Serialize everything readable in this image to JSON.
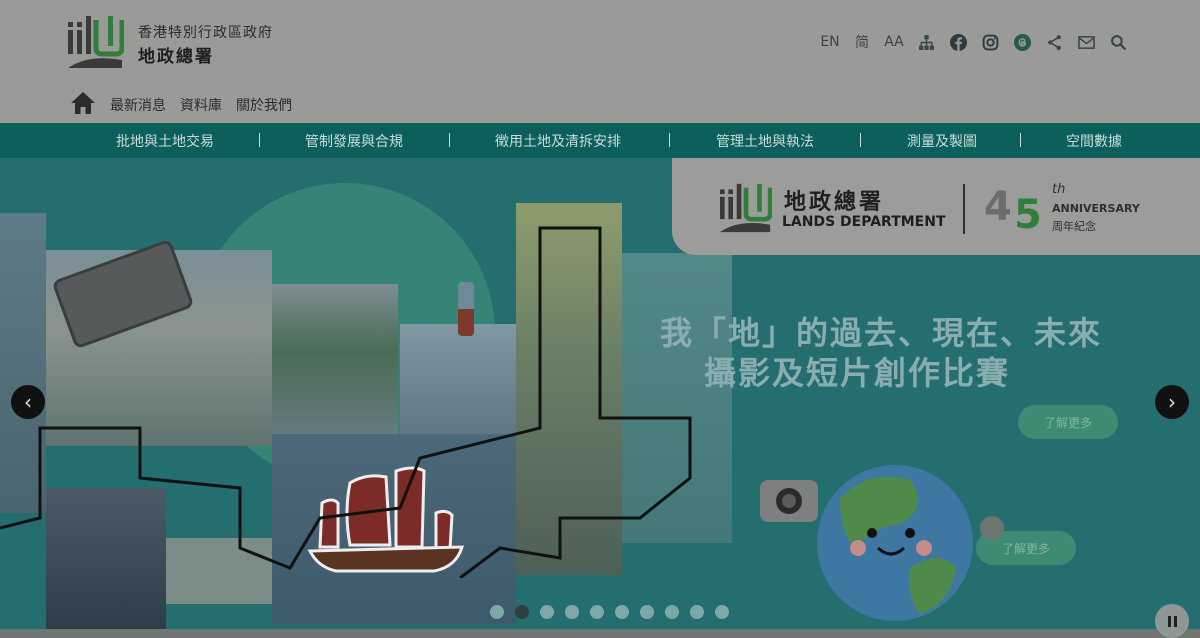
{
  "header": {
    "org_line1": "香港特別行政區政府",
    "org_line2": "地政總署",
    "tools": {
      "lang_en": "EN",
      "lang_sc": "简",
      "font_size": "AA"
    },
    "subnav": [
      "最新消息",
      "資料庫",
      "關於我們"
    ]
  },
  "mainnav": [
    "批地與土地交易",
    "管制發展與合規",
    "徵用土地及清拆安排",
    "管理土地與執法",
    "測量及製圖",
    "空間數據"
  ],
  "banner": {
    "name_zh": "地政總署",
    "name_en": "LANDS DEPARTMENT",
    "anniv_num_1": "4",
    "anniv_num_2": "5",
    "anniv_th": "th",
    "anniv_en": "ANNIVERSARY",
    "anniv_zh": "周年紀念",
    "contest_line1": "我「地」的過去、現在、未來",
    "contest_line2": "攝影及短片創作比賽",
    "more_btn_1": "了解更多",
    "more_btn_2": "了解更多"
  },
  "carousel": {
    "prev": "‹",
    "next": "›",
    "slide_count": 10,
    "active_slide": 2
  },
  "colors": {
    "nav_bg": "#0d5f5c",
    "hero_bg": "#246e70",
    "header_bg": "#9a9a99",
    "accent_green": "#2f7f3a"
  },
  "icons": [
    "sitemap-icon",
    "facebook-icon",
    "instagram-icon",
    "threads-icon",
    "share-icon",
    "mail-icon",
    "search-icon",
    "home-icon"
  ]
}
